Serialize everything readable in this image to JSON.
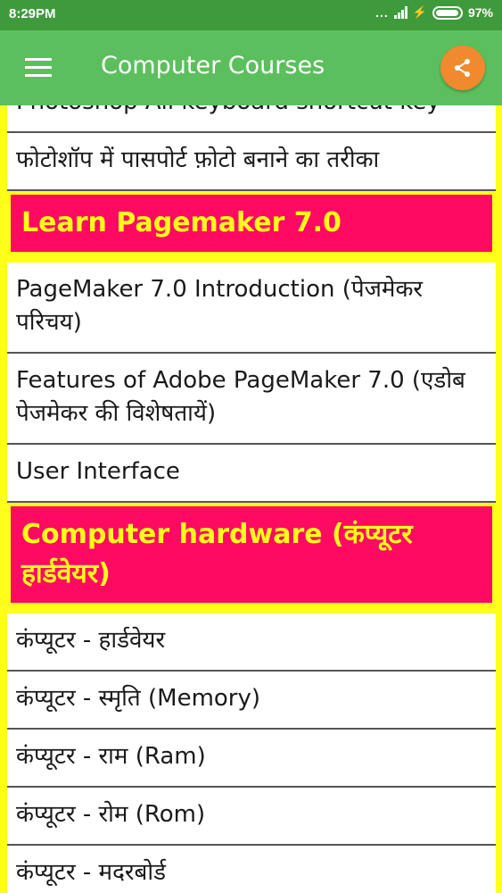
{
  "status_bar": {
    "time": "8:29PM",
    "dots": "...",
    "battery": "97%",
    "battery_level": 0.97
  },
  "app_bar": {
    "title": "Computer Courses",
    "menu_icon": "hamburger-menu-icon",
    "share_icon": "share-icon",
    "accent_color": "#f08a2e",
    "bar_color": "#5cbf5d"
  },
  "items": [
    {
      "type": "item",
      "text": "Photoshop All keyboard shortcut key"
    },
    {
      "type": "item",
      "text": "फोटोशॉप में पासपोर्ट फ़ोटो बनाने का तरीका"
    },
    {
      "type": "header",
      "text": "Learn Pagemaker 7.0"
    },
    {
      "type": "item",
      "text": "PageMaker 7.0 Introduction (पेजमेकर परिचय)"
    },
    {
      "type": "item",
      "text": "Features of Adobe PageMaker 7.0 (एडोब पेजमेकर की विशेषतायें)"
    },
    {
      "type": "item",
      "text": "User Interface"
    },
    {
      "type": "header",
      "text": "Computer hardware (कंप्यूटर हार्डवेयर)"
    },
    {
      "type": "item",
      "text": "कंप्यूटर - हार्डवेयर"
    },
    {
      "type": "item",
      "text": "कंप्यूटर - स्मृति (Memory)"
    },
    {
      "type": "item",
      "text": "कंप्यूटर - राम (Ram)"
    },
    {
      "type": "item",
      "text": "कंप्यूटर - रोम (Rom)"
    },
    {
      "type": "item",
      "text": "कंप्यूटर - मदरबोर्ड"
    }
  ],
  "colors": {
    "header_bg": "#ff0a63",
    "header_text": "#ffff1a",
    "frame": "#ffff1a"
  }
}
